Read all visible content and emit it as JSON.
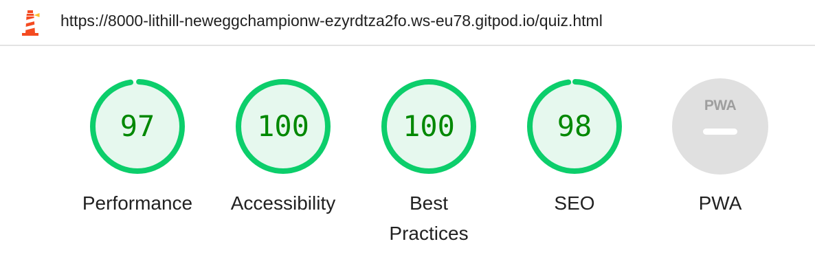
{
  "header": {
    "url": "https://8000-lithill-neweggchampionw-ezyrdtza2fo.ws-eu78.gitpod.io/quiz.html",
    "logo_icon": "lighthouse-icon"
  },
  "colors": {
    "pass": "#0cce6b",
    "pass_fill": "#e6f8ee",
    "pass_text": "#008800",
    "na": "#e0e0e0",
    "na_text": "#9e9e9e",
    "na_bar": "#ffffff"
  },
  "categories": [
    {
      "id": "performance",
      "label": "Performance",
      "score": "97",
      "fraction": 0.97
    },
    {
      "id": "accessibility",
      "label": "Accessibility",
      "score": "100",
      "fraction": 1.0
    },
    {
      "id": "best-practices",
      "label": "Best Practices",
      "label_line1": "Best",
      "label_line2": "Practices",
      "score": "100",
      "fraction": 1.0
    },
    {
      "id": "seo",
      "label": "SEO",
      "score": "98",
      "fraction": 0.98
    },
    {
      "id": "pwa",
      "label": "PWA",
      "badge": "PWA",
      "score": "–"
    }
  ]
}
